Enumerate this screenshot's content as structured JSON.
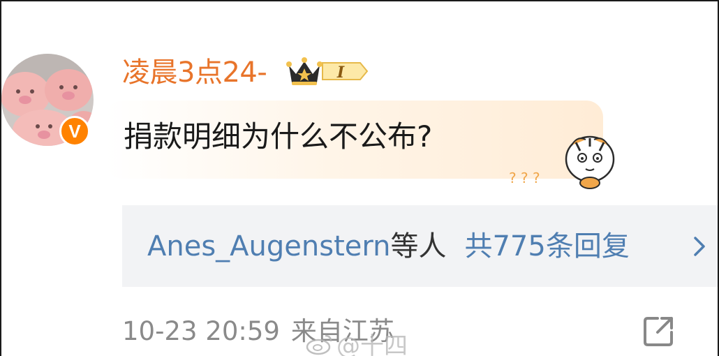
{
  "comment": {
    "username": "凌晨3点24-",
    "vip_level": "I",
    "verified_mark": "V",
    "text": "捐款明细为什么不公布?",
    "sticker_text": "? ? ?"
  },
  "replies": {
    "users": "Anes_Augenstern",
    "suffix": "等人",
    "count_label": "共775条回复"
  },
  "meta": {
    "timestamp": "10-23 20:59",
    "location": "来自江苏"
  },
  "watermark": {
    "text": "@十四"
  },
  "colors": {
    "username": "#e8742a",
    "link": "#4f7eb1",
    "meta": "#8a8a8a",
    "verified": "#ff8200",
    "reply_bg": "#f2f3f5"
  },
  "icons": {
    "verified": "verified-v-icon",
    "vip": "crown-vip-badge-icon",
    "chevron": "chevron-right-icon",
    "share": "share-external-icon",
    "watermark": "weibo-logo-icon"
  }
}
